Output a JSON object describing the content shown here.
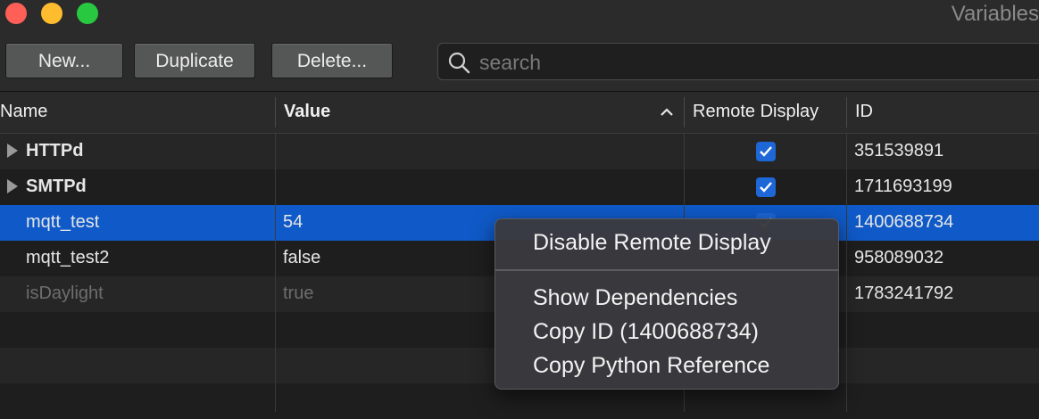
{
  "window": {
    "title": "Variables"
  },
  "toolbar": {
    "new_label": "New...",
    "duplicate_label": "Duplicate",
    "delete_label": "Delete...",
    "search_placeholder": "search"
  },
  "table": {
    "columns": {
      "name": "Name",
      "value": "Value",
      "remote": "Remote Display",
      "id": "ID"
    },
    "sort_column": "Value",
    "rows": [
      {
        "name": "HTTPd",
        "value": "",
        "remote_display": true,
        "id": "351539891",
        "is_folder": true
      },
      {
        "name": "SMTPd",
        "value": "",
        "remote_display": true,
        "id": "1711693199",
        "is_folder": true
      },
      {
        "name": "mqtt_test",
        "value": "54",
        "remote_display": true,
        "id": "1400688734",
        "selected": true
      },
      {
        "name": "mqtt_test2",
        "value": "false",
        "remote_display": false,
        "id": "958089032"
      },
      {
        "name": "isDaylight",
        "value": "true",
        "remote_display": false,
        "id": "1783241792",
        "disabled": true
      }
    ]
  },
  "context_menu": {
    "items": [
      "Disable Remote Display",
      "Show Dependencies",
      "Copy ID (1400688734)",
      "Copy Python Reference"
    ]
  },
  "colors": {
    "selection": "#0f5ac8",
    "checkbox": "#1d67d7",
    "close": "#fe5f57",
    "minimize": "#febc2e",
    "zoom": "#28c840"
  }
}
